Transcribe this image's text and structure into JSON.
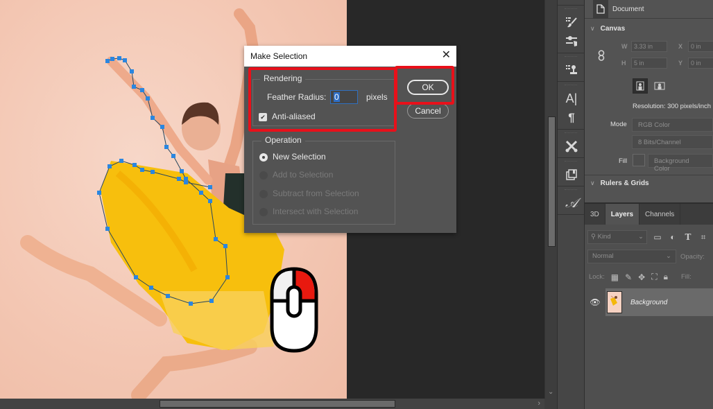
{
  "dialog": {
    "title": "Make Selection",
    "close_icon": "close-icon",
    "rendering": {
      "legend": "Rendering",
      "feather_label": "Feather Radius:",
      "feather_value": "0",
      "feather_unit": "pixels",
      "antialiased_label": "Anti-aliased",
      "antialiased_checked": true
    },
    "operation": {
      "legend": "Operation",
      "options": [
        {
          "label": "New Selection",
          "selected": true,
          "enabled": true
        },
        {
          "label": "Add to Selection",
          "selected": false,
          "enabled": false
        },
        {
          "label": "Subtract from Selection",
          "selected": false,
          "enabled": false
        },
        {
          "label": "Intersect with Selection",
          "selected": false,
          "enabled": false
        }
      ]
    },
    "ok_label": "OK",
    "cancel_label": "Cancel",
    "highlight_color": "#e8101a"
  },
  "toolstrip": {
    "tools": [
      "brush-presets-icon",
      "brush-settings-icon",
      "clone-source-icon",
      "character-icon",
      "paragraph-icon",
      "tool-presets-icon",
      "layer-comps-icon",
      "glyphs-icon"
    ]
  },
  "properties": {
    "document_label": "Document",
    "canvas_section": "Canvas",
    "w_label": "W",
    "w_value": "3.33 in",
    "h_label": "H",
    "h_value": "5 in",
    "x_label": "X",
    "x_value": "0 in",
    "y_label": "Y",
    "y_value": "0 in",
    "resolution": "Resolution: 300 pixels/inch",
    "mode_label": "Mode",
    "mode_value": "RGB Color",
    "depth_value": "8 Bits/Channel",
    "fill_label": "Fill",
    "fill_value": "Background Color",
    "rulers_section": "Rulers & Grids"
  },
  "layers": {
    "tabs": [
      {
        "label": "3D",
        "active": false
      },
      {
        "label": "Layers",
        "active": true
      },
      {
        "label": "Channels",
        "active": false
      }
    ],
    "filter_kind": "Kind",
    "blend_mode": "Normal",
    "opacity_label": "Opacity:",
    "lock_label": "Lock:",
    "fill_label": "Fill:",
    "items": [
      {
        "name": "Background",
        "visible": true
      }
    ]
  },
  "overlay": {
    "mouse_icon": "right-click-mouse-icon",
    "highlight_button": "right"
  }
}
